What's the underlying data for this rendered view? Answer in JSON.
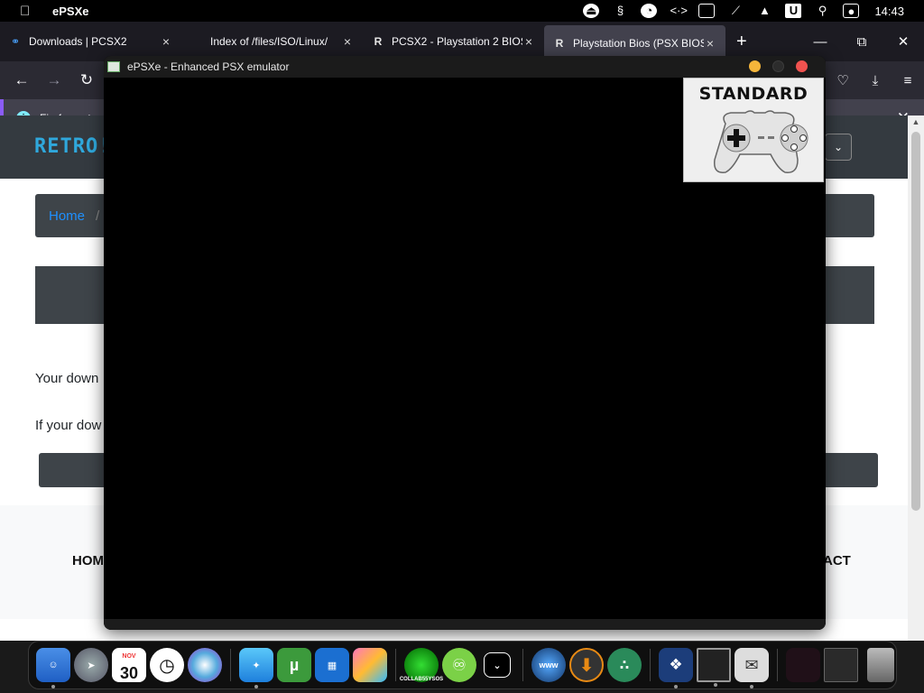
{
  "menubar": {
    "app_name": "ePSXe",
    "clock": "14:43",
    "tray_icons": [
      "eject-icon",
      "script-icon",
      "pie-icon",
      "code-icon",
      "monitor-icon",
      "mute-icon",
      "upload-icon",
      "u-icon",
      "search-icon",
      "control-center-icon"
    ]
  },
  "browser": {
    "tabs": [
      {
        "favicon": "pcsx2-icon",
        "title": "Downloads | PCSX2",
        "close": "×"
      },
      {
        "favicon": "",
        "title": "Index of /files/ISO/Linux/",
        "close": "×"
      },
      {
        "favicon": "R",
        "title": "PCSX2 - Playstation 2 BIOS",
        "close": "×"
      },
      {
        "favicon": "R",
        "title": "Playstation Bios (PSX BIOS)",
        "close": "×"
      }
    ],
    "new_tab": "+",
    "notice_text": "Firefox autom",
    "page": {
      "logo": "RETRO!",
      "breadcrumb_home": "Home",
      "breadcrumb_sep": "/",
      "para1": "Your down",
      "para2": "If your dow",
      "footer_left": "HOM",
      "footer_right": "ACT"
    }
  },
  "epsxe": {
    "title": "ePSXe - Enhanced PSX emulator",
    "controller_label": "STANDARD"
  },
  "dock": {
    "calendar_month": "NOV",
    "calendar_day": "30",
    "collab_label": "COLLAB55YSOS"
  }
}
